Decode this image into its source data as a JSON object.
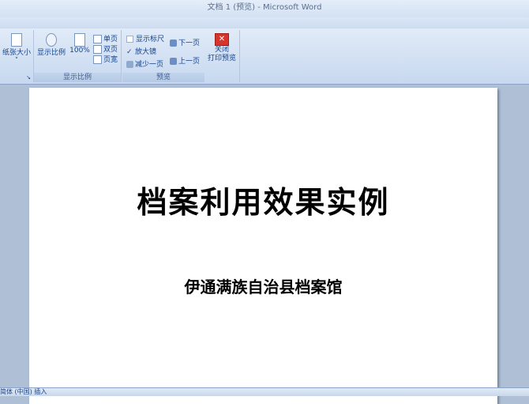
{
  "window": {
    "title": "文档 1 (预览) - Microsoft Word"
  },
  "ribbon": {
    "page_setup": {
      "paper_size_label": "纸张大小"
    },
    "zoom": {
      "group_label": "显示比例",
      "zoom_label": "显示比例",
      "hundred_label": "100%",
      "one_page_label": "单页",
      "two_pages_label": "双页",
      "page_width_label": "页宽"
    },
    "preview": {
      "group_label": "预览",
      "show_ruler_label": "显示标尺",
      "show_ruler_checked": false,
      "magnifier_label": "放大镜",
      "magnifier_checked": true,
      "shrink_one_page_label": "减少一页",
      "next_page_label": "下一页",
      "prev_page_label": "上一页",
      "close_label_1": "关闭",
      "close_label_2": "打印预览"
    }
  },
  "document": {
    "title": "档案利用效果实例",
    "subtitle": "伊通满族自治县档案馆"
  },
  "statusbar": {
    "text": "简体 (中国)   插入"
  },
  "icons": {
    "paper": "page-icon",
    "zoom": "magnifier-icon",
    "close": "close-icon"
  }
}
